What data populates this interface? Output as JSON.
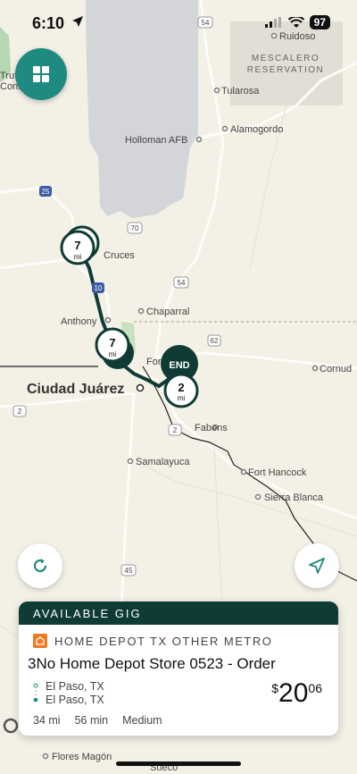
{
  "status": {
    "time": "6:10",
    "battery": "97"
  },
  "map": {
    "labels": {
      "ruidoso": "Ruidoso",
      "mescalero_1": "MESCALERO",
      "mescalero_2": "RESERVATION",
      "tularosa": "Tularosa",
      "holloman": "Holloman AFB",
      "alamogordo": "Alamogordo",
      "cruces": "Cruces",
      "chaparral": "Chaparral",
      "anthony": "Anthony",
      "fort": "For",
      "cornudas": "Cornud",
      "ciudad_juarez": "Ciudad Juárez",
      "fabens": "Fabens",
      "samalayuca": "Samalayuca",
      "fort_hancock": "Fort Hancock",
      "sierra_blanca": "Sierra Blanca",
      "flores_magon": "Flores Magón",
      "sueco": "Sueco",
      "truth_or_cons_1": "Trut",
      "truth_or_cons_2": "Cons"
    },
    "highways": {
      "h54_top": "54",
      "h25": "25",
      "h70": "70",
      "h10": "10",
      "h54_mid": "54",
      "h62": "62",
      "h2_left": "2",
      "h2_mid": "2",
      "h45": "45"
    },
    "markers": {
      "m1_value": "7",
      "m1_unit": "mi",
      "m2_value": "7",
      "m2_unit": "mi",
      "end_label": "END",
      "m3_value": "2",
      "m3_unit": "mi"
    }
  },
  "card": {
    "header": "AVAILABLE GIG",
    "store": "HOME DEPOT TX OTHER METRO",
    "title": "3No   Home Depot Store 0523 - Order",
    "origin": "El Paso, TX",
    "destination": "El Paso, TX",
    "price_currency": "$",
    "price_whole": "20",
    "price_cents": "06",
    "distance": "34 mi",
    "duration": "56 min",
    "size": "Medium"
  },
  "colors": {
    "accent": "#1f8a80",
    "dark_green": "#0f3b35",
    "home_depot": "#f07a21",
    "map_bg": "#f3f0e6",
    "military_area": "#d3d5d9"
  }
}
